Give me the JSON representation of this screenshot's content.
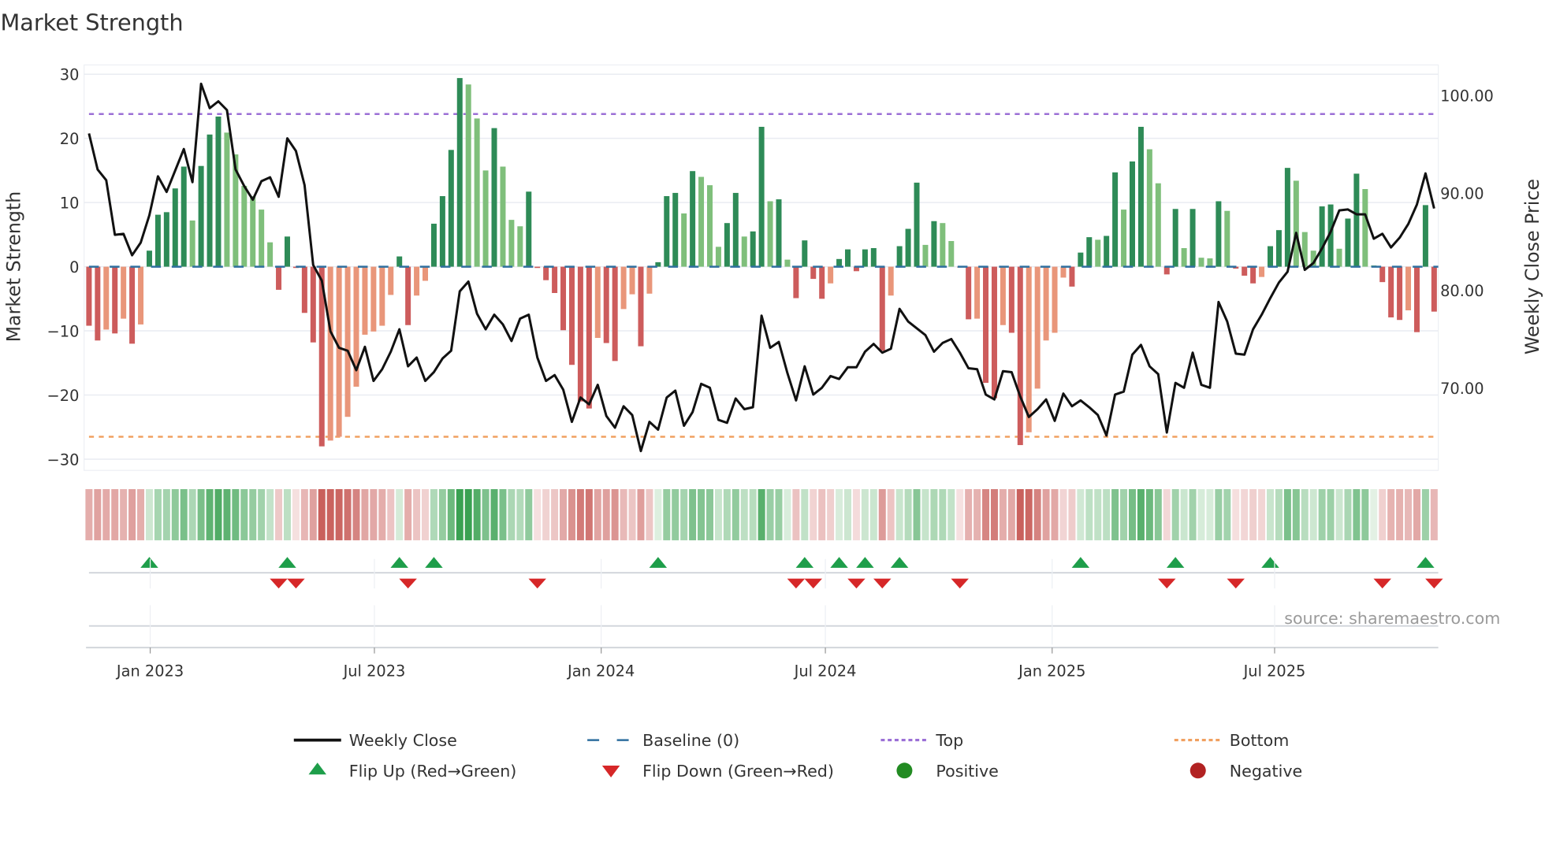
{
  "chart_data": {
    "type": "bar",
    "title": "Market Strength",
    "ylabel": "Market Strength",
    "y2label": "Weekly Close Price",
    "ylim": [
      -32,
      31.5
    ],
    "y2lim": [
      61.8,
      101.9
    ],
    "yticks": [
      30,
      20,
      10,
      0,
      -10,
      -20,
      -30
    ],
    "ytick_labels": [
      "30",
      "20",
      "10",
      "0",
      "−10",
      "−20",
      "−30"
    ],
    "y2ticks": [
      100,
      90,
      80,
      70
    ],
    "y2tick_labels": [
      "100.00",
      "90.00",
      "80.00",
      "70.00"
    ],
    "x_ticks": [
      {
        "label": "Jan 2023",
        "week": 7.1
      },
      {
        "label": "Jul 2023",
        "week": 33.1
      },
      {
        "label": "Jan 2024",
        "week": 59.4
      },
      {
        "label": "Jul 2024",
        "week": 85.4
      },
      {
        "label": "Jan 2025",
        "week": 111.7
      },
      {
        "label": "Jul 2025",
        "week": 137.5
      }
    ],
    "grid": true,
    "top_level": 23.8,
    "bottom_level": -26.5,
    "baseline": 0,
    "strength": [
      -9.2,
      -11.5,
      -9.8,
      -10.4,
      -8.1,
      -12,
      -9,
      2.5,
      8.1,
      8.5,
      12.2,
      15.6,
      7.2,
      15.7,
      20.6,
      23.4,
      20.9,
      17.5,
      12.6,
      11,
      8.9,
      3.8,
      -3.6,
      4.7,
      -0.2,
      -7.2,
      -11.8,
      -28,
      -27.1,
      -26.5,
      -23.4,
      -18.7,
      -10.6,
      -10.1,
      -9.2,
      -4.4,
      1.6,
      -9.1,
      -4.5,
      -2.2,
      6.7,
      11,
      18.2,
      29.4,
      28.4,
      23.1,
      15,
      21.6,
      15.6,
      7.3,
      6.3,
      11.7,
      -0.2,
      -2.1,
      -4.1,
      -9.9,
      -15.3,
      -21,
      -22.1,
      -11.1,
      -11.9,
      -14.7,
      -6.6,
      -4.3,
      -12.4,
      -4.2,
      0.7,
      11,
      11.5,
      8.3,
      14.9,
      14,
      12.7,
      3.1,
      6.8,
      11.5,
      4.7,
      5.5,
      21.8,
      10.2,
      10.5,
      1.1,
      -4.9,
      4.1,
      -1.9,
      -5,
      -2.6,
      1.2,
      2.7,
      -0.7,
      2.7,
      2.9,
      -13.1,
      -4.5,
      3.2,
      5.9,
      13.1,
      3.4,
      7.1,
      6.8,
      4,
      -0.1,
      -8.2,
      -8.1,
      -18.1,
      -20.5,
      -9.1,
      -10.3,
      -27.8,
      -25.8,
      -19,
      -11.5,
      -10.3,
      -1.7,
      -3.1,
      2.2,
      4.6,
      4.2,
      4.8,
      14.7,
      8.9,
      16.4,
      21.8,
      18.3,
      13,
      -1.2,
      9,
      2.9,
      9,
      1.4,
      1.3,
      10.2,
      8.7,
      -0.3,
      -1.4,
      -2.6,
      -1.6,
      3.2,
      5.7,
      15.4,
      13.4,
      5.4,
      2.5,
      9.4,
      9.7,
      2.8,
      7.5,
      14.5,
      12.1,
      0.2,
      -2.4,
      -7.9,
      -8.3,
      -6.8,
      -10.2,
      9.6,
      -7
    ],
    "weekly_close": [
      96.1,
      92.4,
      91.3,
      85.7,
      85.8,
      83.6,
      84.9,
      87.7,
      91.7,
      90.1,
      92.3,
      94.5,
      91.1,
      101.2,
      98.7,
      99.4,
      98.5,
      92.4,
      90.7,
      89.3,
      91.2,
      91.6,
      89.6,
      95.6,
      94.3,
      90.8,
      82.6,
      81,
      75.8,
      74.1,
      73.8,
      71.8,
      74.2,
      70.7,
      71.9,
      73.7,
      76,
      72.2,
      73.1,
      70.7,
      71.6,
      73,
      73.8,
      79.9,
      80.9,
      77.6,
      76,
      77.5,
      76.5,
      74.8,
      77.1,
      77.5,
      73.1,
      70.7,
      71.3,
      69.8,
      66.5,
      69,
      68.3,
      70.3,
      67.1,
      65.9,
      68.1,
      67.2,
      63.5,
      66.5,
      65.7,
      69,
      69.7,
      66.1,
      67.5,
      70.4,
      70,
      66.7,
      66.4,
      68.9,
      67.8,
      68,
      77.4,
      74.1,
      74.7,
      71.5,
      68.7,
      72.2,
      69.3,
      70,
      71.2,
      70.9,
      72.1,
      72.1,
      73.7,
      74.5,
      73.6,
      74,
      78.1,
      76.8,
      76.1,
      75.4,
      73.7,
      74.6,
      75,
      73.6,
      72,
      71.9,
      69.3,
      68.8,
      71.7,
      71.6,
      69.1,
      67,
      67.8,
      68.8,
      66.6,
      69.4,
      68.1,
      68.7,
      68,
      67.2,
      65.1,
      69.3,
      69.6,
      73.4,
      74.4,
      72.2,
      71.4,
      65.4,
      70.5,
      70,
      73.6,
      70.3,
      70,
      78.8,
      76.8,
      73.5,
      73.4,
      76,
      77.5,
      79.2,
      80.8,
      81.9,
      85.9,
      82.1,
      82.8,
      84.3,
      86,
      88.2,
      88.3,
      87.8,
      87.8,
      85.3,
      85.8,
      84.4,
      85.4,
      86.8,
      88.8,
      92,
      88.4
    ],
    "flip_up_weeks": [
      7,
      23,
      36,
      40,
      66,
      83,
      87,
      90,
      94,
      115,
      126,
      137,
      155
    ],
    "flip_down_weeks": [
      22,
      24,
      37,
      52,
      82,
      84,
      89,
      92,
      101,
      125,
      133,
      150,
      156
    ],
    "legend": [
      {
        "label": "Weekly Close",
        "marker": "line"
      },
      {
        "label": "Baseline (0)",
        "marker": "dash"
      },
      {
        "label": "Top",
        "marker": "dot-line-purple"
      },
      {
        "label": "Bottom",
        "marker": "dot-line-orange"
      },
      {
        "label": "Flip Up (Red→Green)",
        "marker": "triangle-up"
      },
      {
        "label": "Flip Down (Green→Red)",
        "marker": "triangle-down"
      },
      {
        "label": "Positive",
        "marker": "circle-green"
      },
      {
        "label": "Negative",
        "marker": "circle-red"
      }
    ],
    "legend_position": "bottom",
    "source": "source: sharemaestro.com",
    "colors": {
      "pos_strong": "#2e8b57",
      "pos_weak": "#7fbf7b",
      "neg_strong": "#cd5c5c",
      "neg_weak": "#e9967a",
      "line": "#111111",
      "baseline": "#2f6f9f",
      "top": "#9b6fd6",
      "bottom": "#f0a060",
      "flip_up": "#1e9e4a",
      "flip_down": "#d62728",
      "positive": "#228b22",
      "negative": "#b22222"
    }
  }
}
